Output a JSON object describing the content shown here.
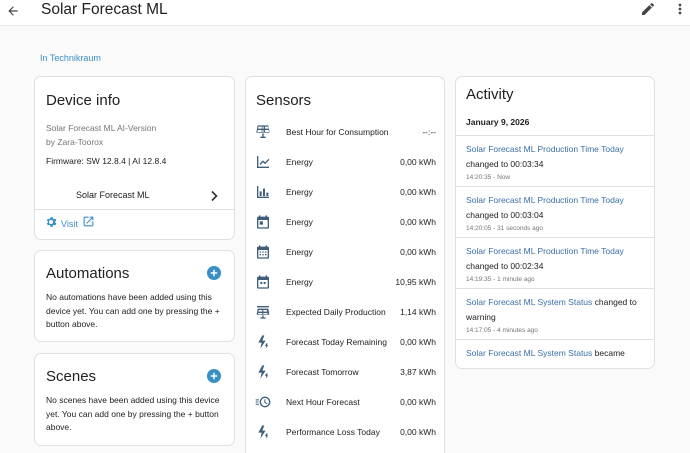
{
  "topbar": {
    "title": "Solar Forecast ML"
  },
  "area": {
    "label": "In Technikraum"
  },
  "device_info": {
    "title": "Device info",
    "model": "Solar Forecast ML AI-Version",
    "manufacturer": "by Zara-Toorox",
    "firmware": "Firmware: SW 12.8.4 | AI 12.8.4",
    "entry_label": "Solar Forecast ML",
    "visit_label": "Visit"
  },
  "automations": {
    "title": "Automations",
    "description": "No automations have been added using this device yet. You can add one by pressing the + button above."
  },
  "scenes": {
    "title": "Scenes",
    "description": "No scenes have been added using this device yet. You can add one by pressing the + button above."
  },
  "sensors": {
    "title": "Sensors",
    "items": [
      {
        "name": "Best Hour for Consumption",
        "value": "--:--",
        "icon": "solar-panel-icon"
      },
      {
        "name": "Energy",
        "value": "0,00 kWh",
        "icon": "chart-line-icon"
      },
      {
        "name": "Energy",
        "value": "0,00 kWh",
        "icon": "chart-bar-icon"
      },
      {
        "name": "Energy",
        "value": "0,00 kWh",
        "icon": "calendar-icon"
      },
      {
        "name": "Energy",
        "value": "0,00 kWh",
        "icon": "calendar-week-icon"
      },
      {
        "name": "Energy",
        "value": "10,95 kWh",
        "icon": "calendar-month-icon"
      },
      {
        "name": "Expected Daily Production",
        "value": "1,14 kWh",
        "icon": "solar-power-icon"
      },
      {
        "name": "Forecast Today Remaining",
        "value": "0,00 kWh",
        "icon": "flash-icon"
      },
      {
        "name": "Forecast Tomorrow",
        "value": "3,87 kWh",
        "icon": "flash-icon"
      },
      {
        "name": "Next Hour Forecast",
        "value": "0,00 kWh",
        "icon": "clock-fast-icon"
      },
      {
        "name": "Performance Loss Today",
        "value": "0,00 kWh",
        "icon": "flash-icon"
      }
    ]
  },
  "activity": {
    "title": "Activity",
    "date": "January 9, 2026",
    "items": [
      {
        "entity": "Solar Forecast ML Production Time Today",
        "text": "changed to 00:03:34",
        "time": "14:20:35 - Now"
      },
      {
        "entity": "Solar Forecast ML Production Time Today",
        "text": "changed to 00:03:04",
        "time": "14:20:05 - 31 seconds ago"
      },
      {
        "entity": "Solar Forecast ML Production Time Today",
        "text": "changed to 00:02:34",
        "time": "14:19:35 - 1 minute ago"
      },
      {
        "entity": "Solar Forecast ML System Status",
        "text": "changed to warning",
        "time": "14:17:05 - 4 minutes ago"
      },
      {
        "entity": "Solar Forecast ML System Status",
        "text": "became",
        "time": ""
      }
    ]
  },
  "colors": {
    "accent": "#3a8fc5",
    "link": "#3a6fa8",
    "icon": "#3e5e7a"
  }
}
